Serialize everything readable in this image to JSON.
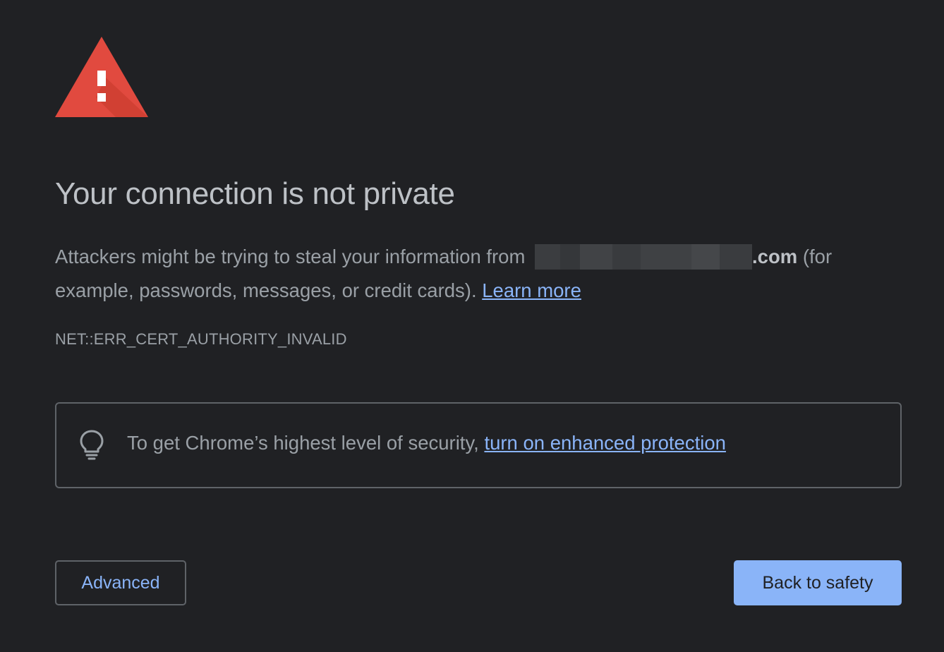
{
  "page": {
    "background_color": "#202124",
    "accent_color": "#8ab4f8",
    "warning_color": "#e14a3f"
  },
  "icons": {
    "warning": "warning-triangle-icon",
    "bulb": "lightbulb-icon"
  },
  "header": {
    "title": "Your connection is not private"
  },
  "description": {
    "text_before": "Attackers might be trying to steal your information from",
    "domain_suffix": ".com",
    "text_after": " (for example, passwords, messages, or credit cards). ",
    "learn_more_label": "Learn more"
  },
  "error": {
    "code": "NET::ERR_CERT_AUTHORITY_INVALID"
  },
  "promo": {
    "text": "To get Chrome’s highest level of security, ",
    "link_label": "turn on enhanced protection"
  },
  "buttons": {
    "advanced_label": "Advanced",
    "back_label": "Back to safety"
  }
}
